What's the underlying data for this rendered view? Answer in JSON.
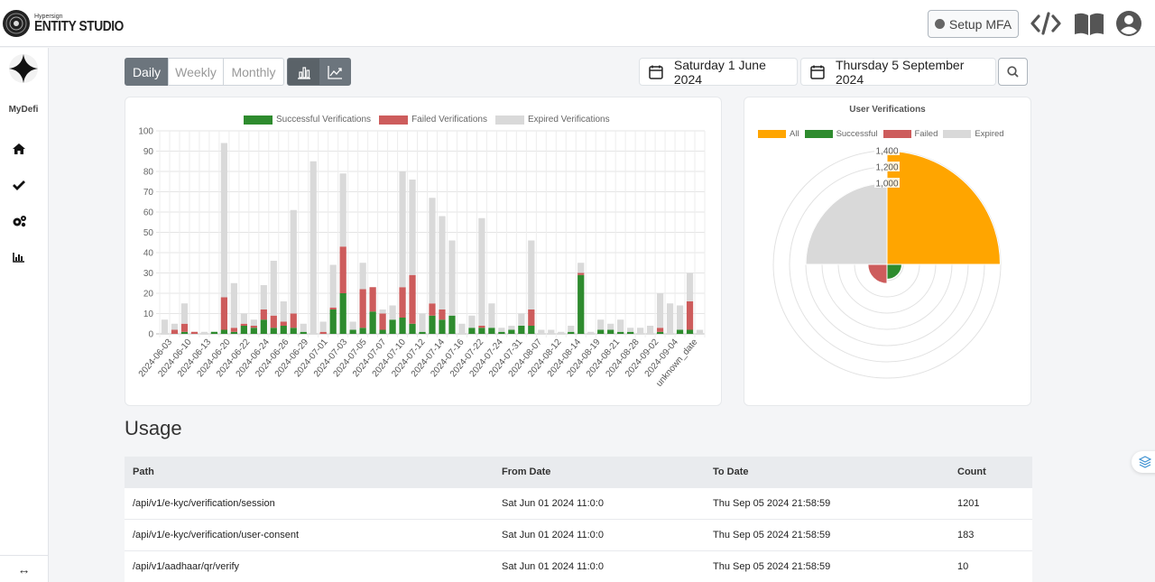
{
  "header": {
    "brand_small": "Hypersign",
    "brand_big": "ENTITY STUDIO",
    "mfa_label": "Setup MFA",
    "icons": [
      "code-icon",
      "book-icon",
      "user-icon"
    ]
  },
  "sidebar": {
    "org_name": "MyDefi",
    "items": [
      {
        "icon": "home-icon"
      },
      {
        "icon": "check-icon"
      },
      {
        "icon": "settings-icon"
      },
      {
        "icon": "bar-chart-icon"
      }
    ],
    "collapse_label": "↔"
  },
  "toolbar": {
    "periods": [
      "Daily",
      "Weekly",
      "Monthly"
    ],
    "active_period": "Daily",
    "chart_toggle": [
      "bar-chart-icon",
      "line-chart-icon"
    ],
    "start_date": "Saturday 1 June 2024",
    "end_date": "Thursday 5 September 2024"
  },
  "colors": {
    "successful": "#2e8b2e",
    "failed": "#cd5c5c",
    "expired": "#d9d9d9",
    "all": "#ffa500"
  },
  "chart_data": [
    {
      "type": "bar",
      "stacked": true,
      "legend": [
        "Successful Verifications",
        "Failed Verifications",
        "Expired Verifications"
      ],
      "legend_position": "top",
      "ylim": [
        0,
        100
      ],
      "yticks": [
        0,
        10,
        20,
        30,
        40,
        50,
        60,
        70,
        80,
        90,
        100
      ],
      "grid": true,
      "x_tick_labels": [
        "2024-06-03",
        "2024-06-10",
        "2024-06-13",
        "2024-06-20",
        "2024-06-22",
        "2024-06-24",
        "2024-06-26",
        "2024-06-29",
        "2024-07-01",
        "2024-07-03",
        "2024-07-05",
        "2024-07-07",
        "2024-07-10",
        "2024-07-12",
        "2024-07-14",
        "2024-07-16",
        "2024-07-22",
        "2024-07-24",
        "2024-07-31",
        "2024-08-07",
        "2024-08-12",
        "2024-08-14",
        "2024-08-19",
        "2024-08-21",
        "2024-08-28",
        "2024-09-02",
        "2024-09-04",
        "unknown_date"
      ],
      "bars": [
        [
          0,
          0,
          7
        ],
        [
          0,
          2,
          3
        ],
        [
          1,
          4,
          10
        ],
        [
          0,
          1,
          0
        ],
        [
          0,
          0,
          1
        ],
        [
          1,
          0,
          0
        ],
        [
          2,
          16,
          76
        ],
        [
          1,
          2,
          22
        ],
        [
          4,
          1,
          5
        ],
        [
          3,
          1,
          3
        ],
        [
          7,
          5,
          12
        ],
        [
          3,
          6,
          27
        ],
        [
          4,
          2,
          10
        ],
        [
          3,
          7,
          51
        ],
        [
          1,
          0,
          4
        ],
        [
          0,
          0,
          85
        ],
        [
          0,
          1,
          5
        ],
        [
          12,
          1,
          21
        ],
        [
          20,
          23,
          36
        ],
        [
          2,
          0,
          4
        ],
        [
          3,
          19,
          13
        ],
        [
          11,
          12,
          0
        ],
        [
          2,
          8,
          2
        ],
        [
          7,
          0,
          7
        ],
        [
          8,
          15,
          57
        ],
        [
          5,
          24,
          47
        ],
        [
          1,
          0,
          9
        ],
        [
          9,
          6,
          52
        ],
        [
          7,
          5,
          46
        ],
        [
          9,
          0,
          37
        ],
        [
          0,
          0,
          5
        ],
        [
          3,
          0,
          6
        ],
        [
          3,
          1,
          53
        ],
        [
          3,
          0,
          12
        ],
        [
          1,
          0,
          2
        ],
        [
          2,
          0,
          2
        ],
        [
          4,
          0,
          6
        ],
        [
          4,
          8,
          34
        ],
        [
          0,
          0,
          2
        ],
        [
          0,
          0,
          2
        ],
        [
          0,
          0,
          1
        ],
        [
          1,
          0,
          3
        ],
        [
          29,
          1,
          5
        ],
        [
          0,
          0,
          1
        ],
        [
          2,
          0,
          5
        ],
        [
          2,
          0,
          3
        ],
        [
          1,
          0,
          6
        ],
        [
          1,
          0,
          2
        ],
        [
          0,
          0,
          3
        ],
        [
          0,
          0,
          4
        ],
        [
          1,
          2,
          17
        ],
        [
          0,
          0,
          15
        ],
        [
          2,
          0,
          12
        ],
        [
          2,
          14,
          14
        ],
        [
          0,
          0,
          2
        ]
      ]
    },
    {
      "type": "polar",
      "title": "User Verifications",
      "legend": [
        "All",
        "Successful",
        "Failed",
        "Expired"
      ],
      "values": [
        1394,
        183,
        235,
        1000
      ],
      "rmax": 1400,
      "ticks": [
        1000,
        1200,
        1400
      ]
    }
  ],
  "usage": {
    "title": "Usage",
    "columns": [
      "Path",
      "From Date",
      "To Date",
      "Count"
    ],
    "rows": [
      [
        "/api/v1/e-kyc/verification/session",
        "Sat Jun 01 2024 11:0:0",
        "Thu Sep 05 2024 21:58:59",
        "1201"
      ],
      [
        "/api/v1/e-kyc/verification/user-consent",
        "Sat Jun 01 2024 11:0:0",
        "Thu Sep 05 2024 21:58:59",
        "183"
      ],
      [
        "/api/v1/aadhaar/qr/verify",
        "Sat Jun 01 2024 11:0:0",
        "Thu Sep 05 2024 21:58:59",
        "10"
      ]
    ]
  }
}
